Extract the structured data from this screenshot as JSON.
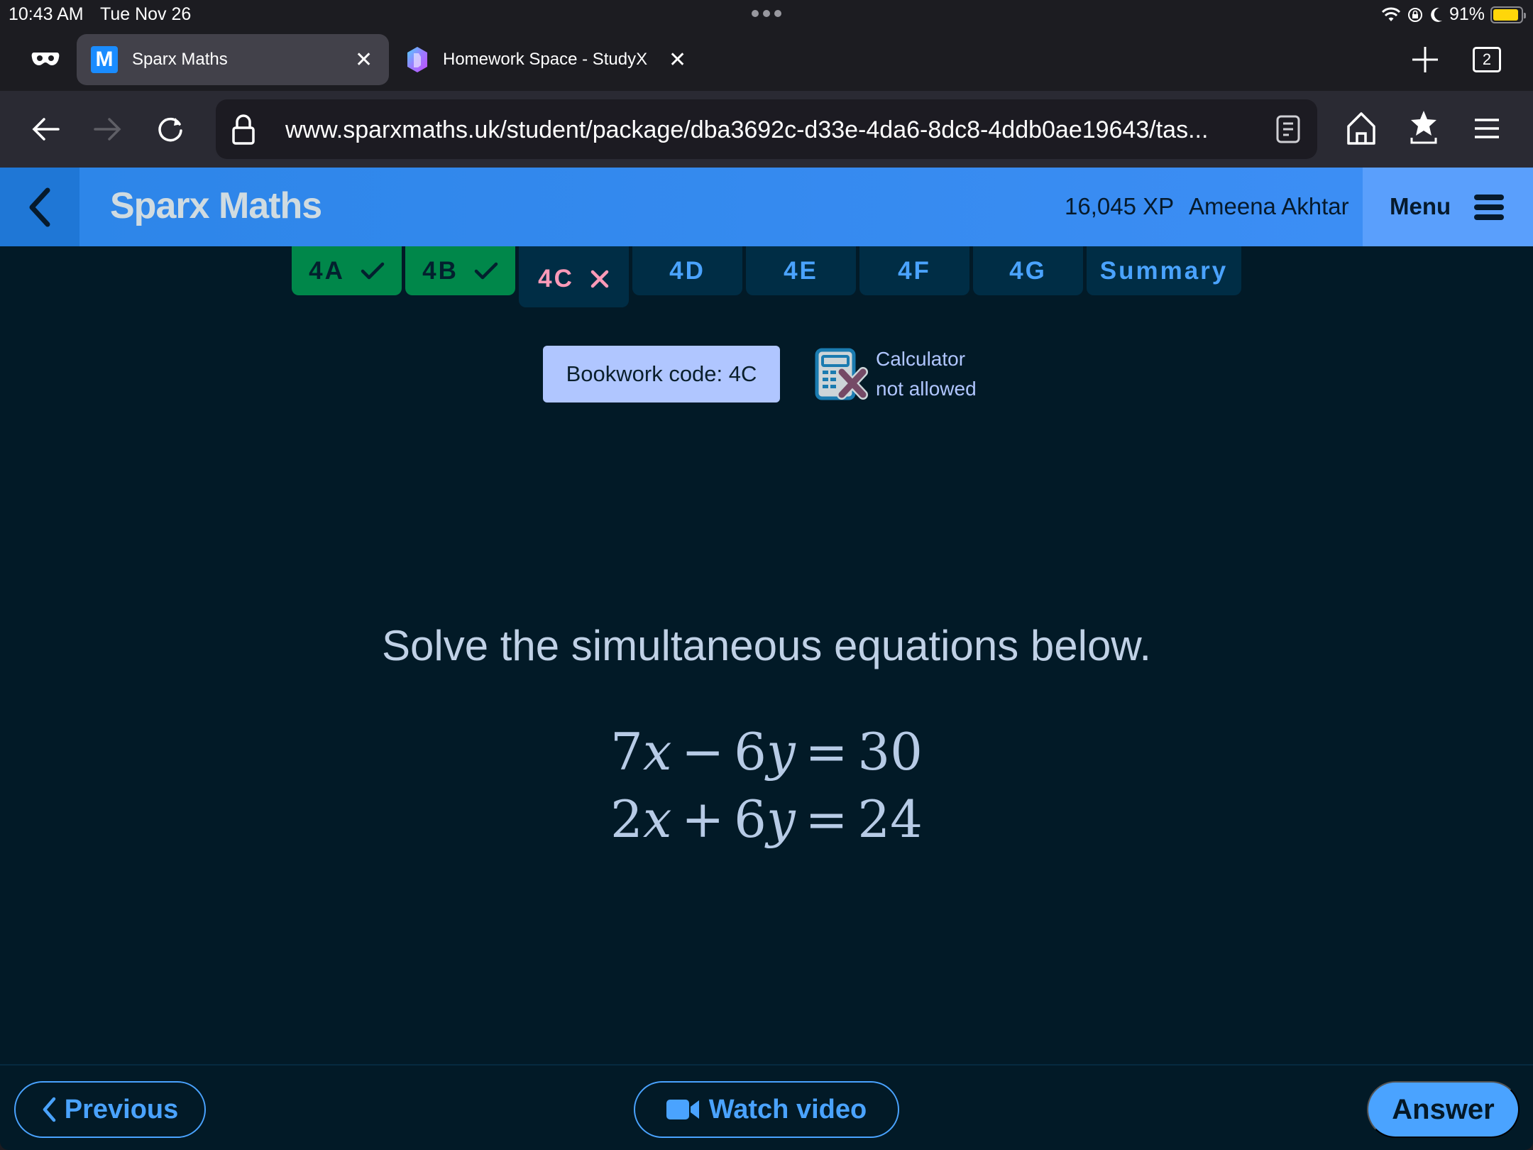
{
  "status_bar": {
    "time": "10:43 AM",
    "date": "Tue Nov 26",
    "battery_percent": "91%",
    "battery_level": 0.91,
    "icons": [
      "wifi-icon",
      "orientation-lock-icon",
      "moon-icon",
      "battery-icon"
    ]
  },
  "browser": {
    "tabs": [
      {
        "title": "Sparx Maths",
        "favicon": "M",
        "active": true
      },
      {
        "title": "Homework Space - StudyX",
        "favicon": "studyx-gem",
        "active": false
      }
    ],
    "tab_count": "2",
    "url": "www.sparxmaths.uk/student/package/dba3692c-d33e-4da6-8dc8-4ddb0ae19643/tas..."
  },
  "header": {
    "brand": "Sparx Maths",
    "xp": "16,045 XP",
    "username": "Ameena Akhtar",
    "menu_label": "Menu"
  },
  "sections": [
    {
      "label": "4A",
      "status": "complete"
    },
    {
      "label": "4B",
      "status": "complete"
    },
    {
      "label": "4C",
      "status": "current-incorrect"
    },
    {
      "label": "4D",
      "status": "todo"
    },
    {
      "label": "4E",
      "status": "todo"
    },
    {
      "label": "4F",
      "status": "todo"
    },
    {
      "label": "4G",
      "status": "todo"
    },
    {
      "label": "Summary",
      "status": "todo"
    }
  ],
  "bookwork": {
    "label": "Bookwork code: 4C",
    "calculator_line1": "Calculator",
    "calculator_line2": "not allowed"
  },
  "question": {
    "prompt": "Solve the simultaneous equations below.",
    "equations": [
      {
        "c1": "7",
        "v1": "x",
        "op": "−",
        "c2": "6",
        "v2": "y",
        "eq": "=",
        "rhs": "30"
      },
      {
        "c1": "2",
        "v1": "x",
        "op": "+",
        "c2": "6",
        "v2": "y",
        "eq": "=",
        "rhs": "24"
      }
    ]
  },
  "footer": {
    "previous_label": "Previous",
    "watch_video_label": "Watch video",
    "answer_label": "Answer"
  },
  "colors": {
    "header_blue": "#3e8ff6",
    "accent_blue": "#4aa3ff",
    "complete_green": "#00874a",
    "incorrect_pink": "#ff9ab8",
    "page_bg": "#021a27",
    "bookwork_bg": "#b0c6ff"
  }
}
